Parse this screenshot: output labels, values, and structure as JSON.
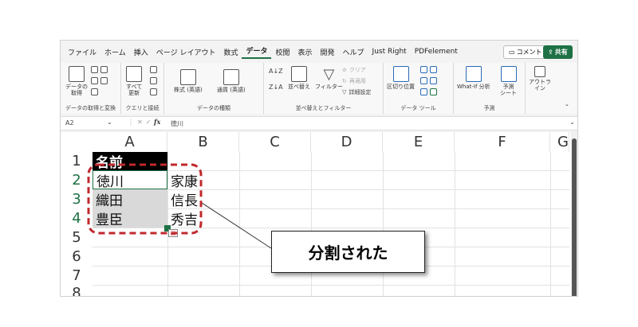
{
  "menu": {
    "items": [
      "ファイル",
      "ホーム",
      "挿入",
      "ページ レイアウト",
      "数式",
      "データ",
      "校閲",
      "表示",
      "開発",
      "ヘルプ",
      "Just Right",
      "PDFelement"
    ],
    "active_index": 5,
    "comment_label": "コメント",
    "share_label": "共有"
  },
  "ribbon": {
    "get_data_label": "データの\n取得",
    "get_transform_group": "データの取得と変換",
    "refresh_label": "すべて\n更新",
    "queries_group": "クエリと接続",
    "stocks_label": "株式 (英語)",
    "currency_label": "通貨 (英語)",
    "datatype_group": "データの種類",
    "sort_label": "並べ替え",
    "filter_label": "フィルター",
    "clear_label": "クリア",
    "reapply_label": "再適用",
    "advanced_label": "詳細設定",
    "sortfilter_group": "並べ替えとフィルター",
    "text_to_columns_label": "区切り位置",
    "datatools_group": "データ ツール",
    "whatif_label": "What-If 分析",
    "forecast_sheet_label": "予測\nシート",
    "outline_label": "アウトラ\nイン",
    "forecast_group": "予測"
  },
  "formula_bar": {
    "name_box": "A2",
    "fx": "fx",
    "value": "徳川"
  },
  "grid": {
    "columns": [
      "A",
      "B",
      "C",
      "D",
      "E",
      "F",
      "G"
    ],
    "rows": [
      "1",
      "2",
      "3",
      "4",
      "5",
      "6",
      "7",
      "8"
    ],
    "selected_rows": [
      2,
      3,
      4
    ],
    "cells": {
      "A1": "名前",
      "A2": "徳川",
      "A3": "織田",
      "A4": "豊臣",
      "B2": "家康",
      "B3": "信長",
      "B4": "秀吉"
    }
  },
  "callout": {
    "text": "分割された"
  },
  "colors": {
    "accent": "#1e7145",
    "highlight_border": "#c0282d",
    "selection_fill": "#d9d9d9"
  }
}
